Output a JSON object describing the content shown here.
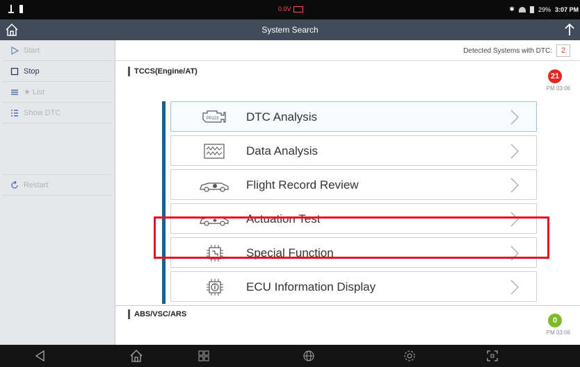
{
  "status_bar": {
    "voltage": "0.0V",
    "battery_percent": "29%",
    "time": "3:07 PM"
  },
  "title_bar": {
    "title": "System Search"
  },
  "sidebar": {
    "items": [
      {
        "label": "Start",
        "icon": "play-icon",
        "enabled": false
      },
      {
        "label": "Stop",
        "icon": "stop-icon",
        "enabled": true
      },
      {
        "label": "★ List",
        "icon": "list-icon",
        "enabled": false
      },
      {
        "label": "Show DTC",
        "icon": "dtc-list-icon",
        "enabled": false
      },
      {
        "label": "Restart",
        "icon": "restart-icon",
        "enabled": false
      }
    ]
  },
  "detected": {
    "label": "Detected Systems with DTC:",
    "count": "2"
  },
  "systems": [
    {
      "name": "TCCS(Engine/AT)",
      "dtc_count": "21",
      "time": "PM 03:06",
      "badge_color": "#e3281f"
    },
    {
      "name": "ABS/VSC/ARS",
      "dtc_count": "0",
      "time": "PM 03:06",
      "badge_color": "#7dbb2a"
    }
  ],
  "menu": [
    {
      "label": "DTC Analysis",
      "icon": "engine-dtc-icon"
    },
    {
      "label": "Data Analysis",
      "icon": "waveform-icon"
    },
    {
      "label": "Flight Record Review",
      "icon": "car-record-icon"
    },
    {
      "label": "Actuation Test",
      "icon": "car-actuation-icon"
    },
    {
      "label": "Special Function",
      "icon": "chip-special-icon"
    },
    {
      "label": "ECU Information Display",
      "icon": "chip-info-icon"
    }
  ],
  "accent_color": "#1f5f8b",
  "highlight_color": "#e8141d"
}
